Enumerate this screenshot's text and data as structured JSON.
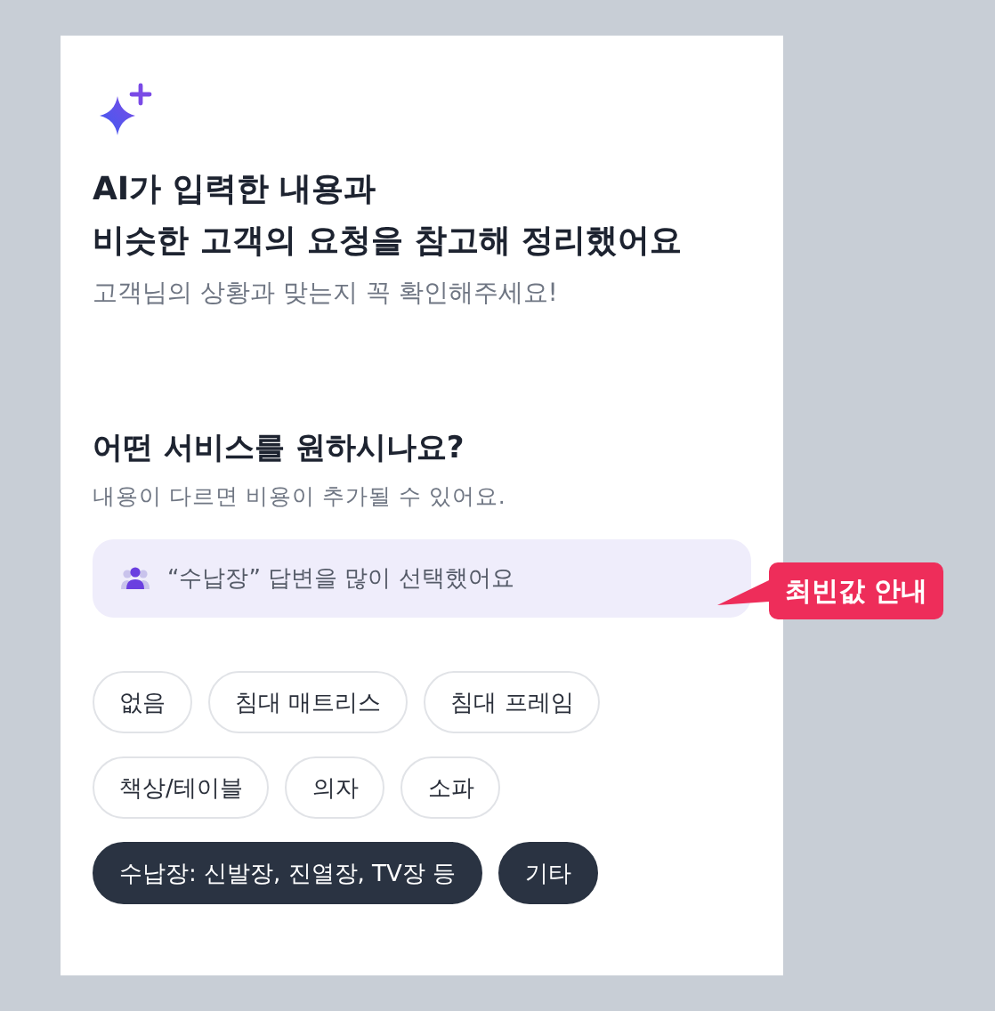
{
  "header": {
    "title_lines": [
      "AI가 입력한 내용과",
      "비슷한 고객의 요청을 참고해 정리했어요"
    ],
    "subtitle": "고객님의 상황과 맞는지 꼭 확인해주세요!"
  },
  "question": {
    "title": "어떤 서비스를 원하시나요?",
    "note": "내용이 다르면 비용이 추가될 수 있어요.",
    "hint": "“수납장” 답변을 많이 선택했어요",
    "callout": "최빈값 안내"
  },
  "options": [
    {
      "label": "없음",
      "selected": false
    },
    {
      "label": "침대 매트리스",
      "selected": false
    },
    {
      "label": "침대 프레임",
      "selected": false
    },
    {
      "label": "책상/테이블",
      "selected": false
    },
    {
      "label": "의자",
      "selected": false
    },
    {
      "label": "소파",
      "selected": false
    },
    {
      "label": "수납장: 신발장, 진열장, TV장 등",
      "selected": true
    },
    {
      "label": "기타",
      "selected": true
    }
  ]
}
